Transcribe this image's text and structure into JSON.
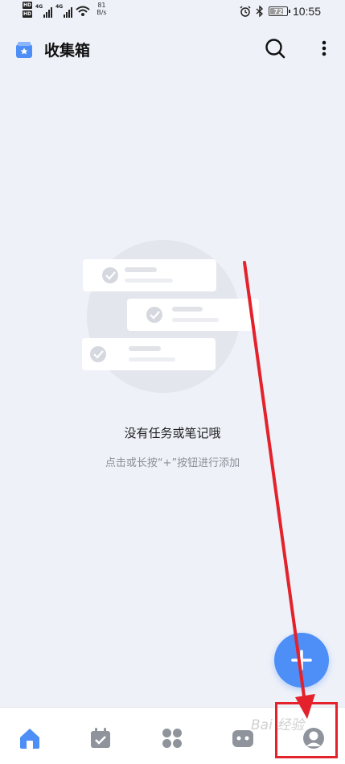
{
  "status_bar": {
    "sim1": "HD",
    "sim2": "HD",
    "network1": "4G",
    "network2": "4G",
    "speed_value": "81",
    "speed_unit": "B/s",
    "battery": "72",
    "time": "10:55"
  },
  "header": {
    "title": "收集箱",
    "icon": "inbox-star-icon",
    "search_icon": "search-icon",
    "more_icon": "more-vertical-icon"
  },
  "empty_state": {
    "title": "没有任务或笔记哦",
    "subtitle": "点击或长按“+”按钮进行添加"
  },
  "fab": {
    "icon": "plus-icon"
  },
  "bottom_nav": {
    "items": [
      {
        "icon": "home-icon",
        "active": true
      },
      {
        "icon": "calendar-check-icon",
        "active": false
      },
      {
        "icon": "grid-apps-icon",
        "active": false
      },
      {
        "icon": "robot-icon",
        "active": false
      },
      {
        "icon": "profile-icon",
        "active": false
      }
    ]
  },
  "watermark": "Bai 经验",
  "colors": {
    "accent": "#4d8ff7",
    "background": "#eef1f8",
    "annotation": "#e3222b",
    "nav_icon": "#8e939c"
  }
}
